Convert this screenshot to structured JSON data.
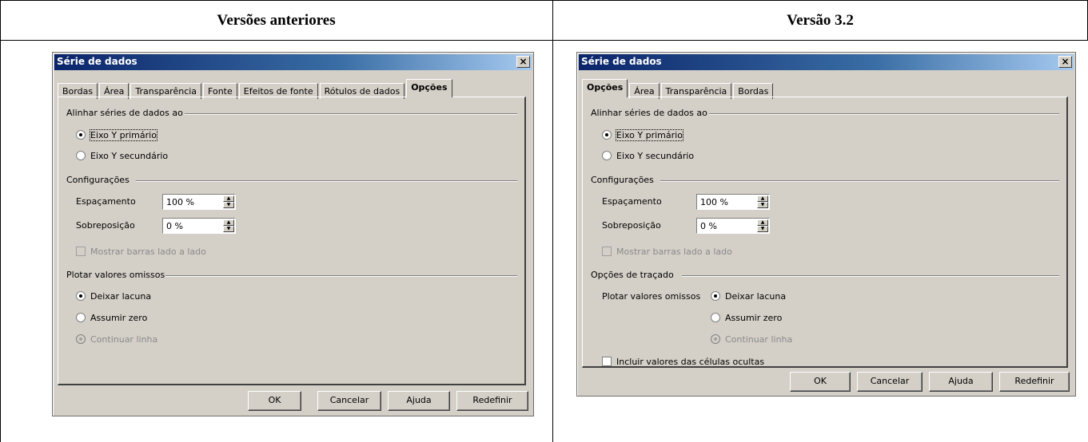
{
  "columns": {
    "left_header": "Versões anteriores",
    "right_header": "Versão 3.2"
  },
  "old_dialog": {
    "title": "Série de dados",
    "close": "×",
    "tabs": [
      "Bordas",
      "Área",
      "Transparência",
      "Fonte",
      "Efeitos de fonte",
      "Rótulos de dados",
      "Opções"
    ],
    "active_tab": "Opções",
    "align_group": "Alinhar séries de dados ao",
    "primary_axis": "Eixo Y primário",
    "secondary_axis": "Eixo Y secundário",
    "settings_group": "Configurações",
    "spacing_label": "Espaçamento",
    "spacing_value": "100 %",
    "overlap_label": "Sobreposição",
    "overlap_value": "0 %",
    "show_bars": "Mostrar barras lado a lado",
    "missing_group": "Plotar valores omissos",
    "leave_gap": "Deixar lacuna",
    "assume_zero": "Assumir zero",
    "continue_line": "Continuar linha",
    "buttons": {
      "ok": "OK",
      "cancel": "Cancelar",
      "help": "Ajuda",
      "reset": "Redefinir"
    }
  },
  "new_dialog": {
    "title": "Série de dados",
    "close": "×",
    "tabs": [
      "Opções",
      "Área",
      "Transparência",
      "Bordas"
    ],
    "active_tab": "Opções",
    "align_group": "Alinhar séries de dados ao",
    "primary_axis": "Eixo Y primário",
    "secondary_axis": "Eixo Y secundário",
    "settings_group": "Configurações",
    "spacing_label": "Espaçamento",
    "spacing_value": "100 %",
    "overlap_label": "Sobreposição",
    "overlap_value": "0 %",
    "show_bars": "Mostrar barras lado a lado",
    "plot_options_group": "Opções de traçado",
    "missing_label": "Plotar valores omissos",
    "leave_gap": "Deixar lacuna",
    "assume_zero": "Assumir zero",
    "continue_line": "Continuar linha",
    "include_hidden": "Incluir valores das células ocultas",
    "buttons": {
      "ok": "OK",
      "cancel": "Cancelar",
      "help": "Ajuda",
      "reset": "Redefinir"
    }
  }
}
